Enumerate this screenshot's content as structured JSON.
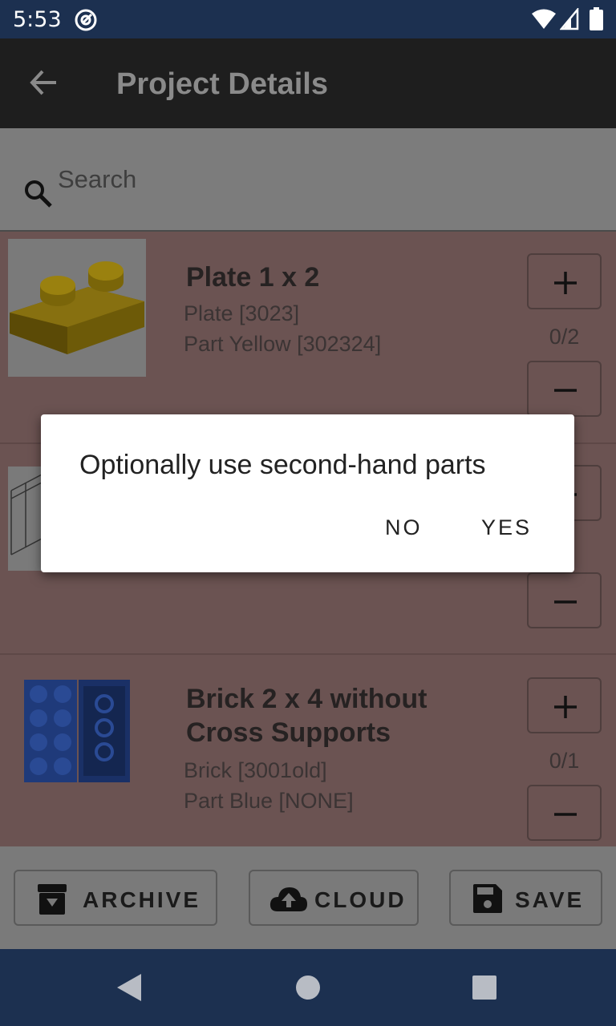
{
  "status_bar": {
    "time": "5:53",
    "icons": [
      "at-sign-icon",
      "wifi-icon",
      "signal-icon",
      "battery-icon"
    ]
  },
  "app_bar": {
    "title": "Project Details",
    "back_icon": "arrow-left-icon"
  },
  "search": {
    "placeholder": "Search",
    "icon": "search-icon"
  },
  "parts": [
    {
      "title": "Plate 1 x 2",
      "category": "Plate [3023]",
      "color": "Part Yellow [302324]",
      "count": "0/2"
    },
    {
      "title": "",
      "category": "",
      "color": "",
      "count": ""
    },
    {
      "title": "Brick 2 x 4 without Cross Supports",
      "category": "Brick [3001old]",
      "color": "Part Blue [NONE]",
      "count": "0/1"
    }
  ],
  "actions": {
    "archive": "ARCHIVE",
    "cloud": "CLOUD",
    "save": "SAVE"
  },
  "dialog": {
    "message": "Optionally use second-hand parts",
    "no": "NO",
    "yes": "YES"
  },
  "nav": {
    "icons": [
      "back-triangle-icon",
      "home-circle-icon",
      "recents-square-icon"
    ]
  },
  "colors": {
    "status_bar": "#1c3050",
    "overlay_list": "#6b5352",
    "dialog_bg": "#ffffff"
  }
}
